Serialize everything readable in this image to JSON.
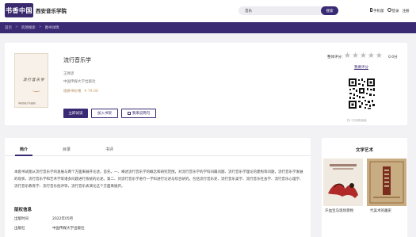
{
  "header": {
    "logo_text": "书香中国",
    "site_name": "西安音乐学院",
    "search": {
      "value": "音乐",
      "button_label": "搜索"
    },
    "links": {
      "mobile": "手机版",
      "login": "登录",
      "register": "注册"
    }
  },
  "breadcrumb": {
    "items": [
      "首页",
      "资源搜索",
      "图书详情"
    ],
    "separator": ">"
  },
  "book": {
    "title": "流行音乐学",
    "author": "王佩思",
    "publisher": "中国传媒大学出版社",
    "price_label": "纸质书价格",
    "price": "¥ 79.00",
    "cover_title": "流行音乐学",
    "cover_publisher": "中国传媒大学出版社",
    "buttons": {
      "read": "立即试读",
      "add_shelf": "加入书架",
      "share": "我来说两句"
    }
  },
  "rating": {
    "label": "整体评分:",
    "stars": 0,
    "max_stars": 5,
    "score": "0.0分",
    "rate_link": "我要评分"
  },
  "qr_caption": "扫一扫手机阅读",
  "detail_tabs": {
    "items": [
      "简介",
      "目录",
      "书评"
    ],
    "active": 0
  },
  "intro": "本套书试图从流行音乐学的发展与两个方面来展开论述。首先，一、阐述流行音乐学的概念和研究范围，对流行音乐学的学科归属问题、流行音乐学理论的建构等问题，流行音乐学发展的现状、流行音乐学和艺术学等诸多问题进行系统的论述。第二、对流行音乐学进行一学科进行论述与综合研究，包括流行音乐史、流行音乐美学、流行音乐社会学、流行音乐心理学、流行音乐教育学、流行音乐批评等，流行音乐表演论这个方面来展开。",
  "metadata": {
    "title": "版权信息",
    "rows": [
      {
        "label": "出版时间",
        "value": "2022年05月"
      },
      {
        "label": "出版社",
        "value": "中国传媒大学出版社"
      }
    ]
  },
  "side": {
    "title": "文学艺术",
    "items": [
      {
        "title": "汗血宝马现场景物"
      },
      {
        "title": "代美术的趣史"
      }
    ]
  },
  "colors": {
    "brand": "#3a2973",
    "price": "#c89a5c",
    "star_empty": "#bdbdbd",
    "page_bg": "#f2f2f5"
  }
}
